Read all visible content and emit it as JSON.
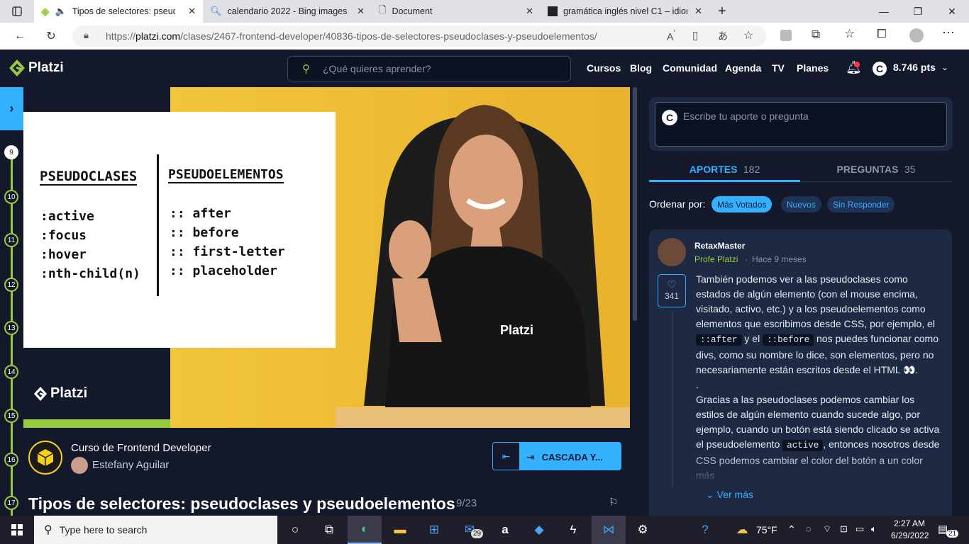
{
  "browser": {
    "tabs": [
      {
        "title": "Tipos de selectores: pseudo",
        "active": true
      },
      {
        "title": "calendario 2022 - Bing images",
        "active": false
      },
      {
        "title": "Document",
        "active": false
      },
      {
        "title": "gramática inglés nivel C1 – idiom",
        "active": false
      }
    ],
    "url_prefix": "https://",
    "url_host": "platzi.com",
    "url_path": "/clases/2467-frontend-developer/40836-tipos-de-selectores-pseudoclases-y-pseudoelementos/"
  },
  "header": {
    "logo": "Platzi",
    "search_placeholder": "¿Qué quieres aprender?",
    "nav": [
      "Cursos",
      "Blog",
      "Comunidad",
      "Agenda",
      "TV",
      "Planes"
    ],
    "points": "8.746 pts"
  },
  "lessons": [
    "9",
    "10",
    "11",
    "12",
    "13",
    "14",
    "15",
    "16",
    "17"
  ],
  "video": {
    "whiteboard_left_title": "PSEUDOCLASES",
    "whiteboard_left_items": [
      ":active",
      ":focus",
      ":hover",
      ":nth-child(n)"
    ],
    "whiteboard_right_title": "PSEUDOELEMENTOS",
    "whiteboard_right_items": [
      ":: after",
      ":: before",
      ":: first-letter",
      ":: placeholder"
    ],
    "watermark": "Platzi",
    "shirt_logo": "Platzi"
  },
  "course": {
    "title": "Curso de Frontend Developer",
    "teacher": "Estefany Aguilar",
    "next_label": "CASCADA Y...",
    "class_title": "Tipos de selectores: pseudoclases y pseudoelementos",
    "class_index": "9/23"
  },
  "sidebar": {
    "input_placeholder": "Escribe tu aporte o pregunta",
    "tab_aportes": "APORTES",
    "tab_aportes_count": "182",
    "tab_preguntas": "PREGUNTAS",
    "tab_preguntas_count": "35",
    "sort_label": "Ordenar por:",
    "sort_options": [
      "Más Votados",
      "Nuevos",
      "Sin Responder"
    ]
  },
  "comment": {
    "author": "RetaxMaster",
    "role": "Profe Platzi",
    "time": "Hace 9 meses",
    "likes": "341",
    "p1a": "También podemos ver a las pseudoclases como estados de algún elemento (con el mouse encima, visitado, activo, etc.) y a los pseudoelementos como elementos que escribimos desde CSS, por ejemplo, el",
    "code1": "::after",
    "p1b": "y el",
    "code2": "::before",
    "p1c": "nos puedes funcionar como divs, como su nombre lo dice, son elementos, pero no necesariamente están escritos desde el HTML 👀.",
    "dot": ".",
    "p2a": "Gracias a las pseudoclases podemos cambiar los estilos de algún elemento cuando sucede algo, por ejemplo, cuando un botón está siendo clicado se activa el pseudoelemento",
    "code3": "active",
    "p2b": ", entonces nosotros desde CSS podemos cambiar el color del botón a un color más",
    "more": "Ver más"
  },
  "taskbar": {
    "search": "Type here to search",
    "mail_badge": "29",
    "weather": "75°F",
    "time": "2:27 AM",
    "date": "6/29/2022",
    "notif": "21"
  },
  "colors": {
    "accent": "#98ca3f",
    "blue": "#33b1ff",
    "bg": "#13192b"
  }
}
